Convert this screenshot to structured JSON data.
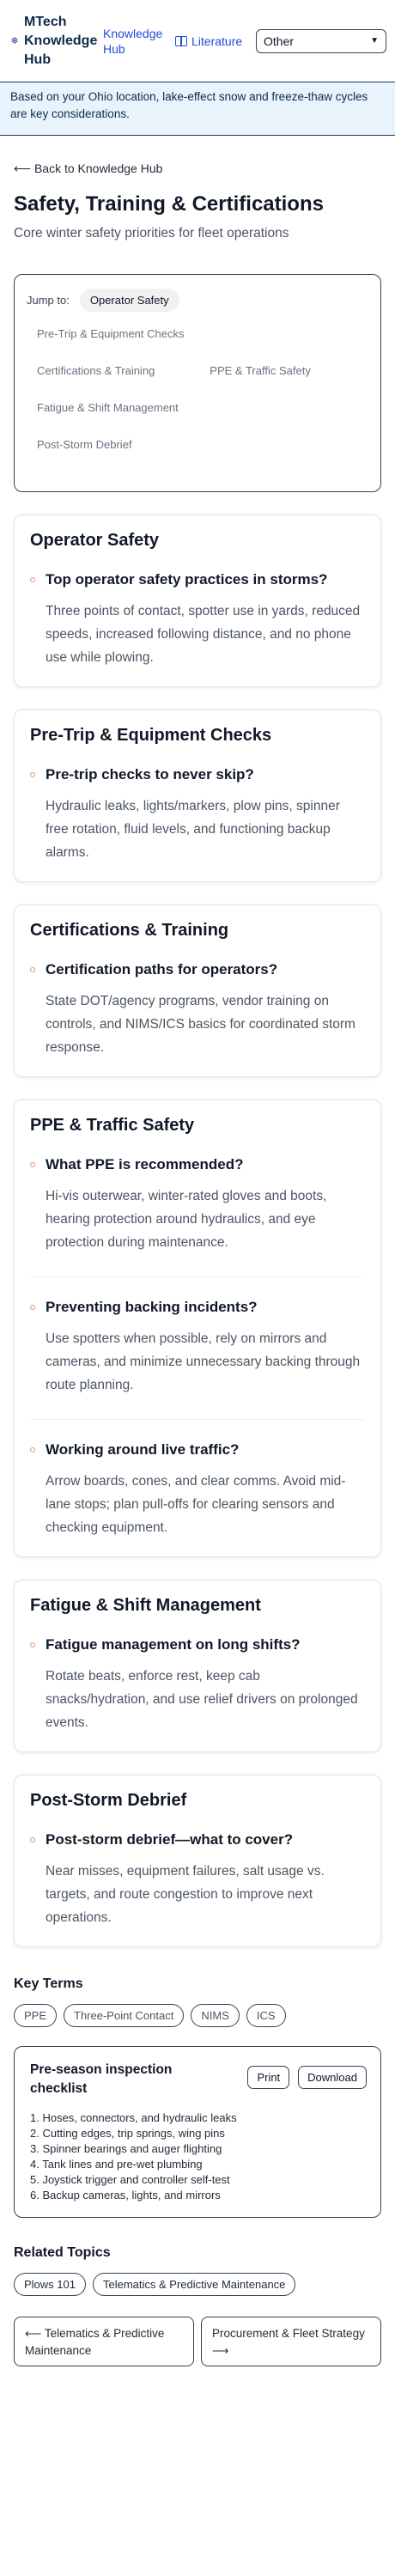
{
  "header": {
    "brand": "MTech Knowledge Hub",
    "brand_icon": "snowflake-icon",
    "nav_knowledge": "Knowledge Hub",
    "nav_literature": "Literature",
    "nav_literature_icon": "book-icon",
    "select_value": "Other"
  },
  "banner": "Based on your Ohio location, lake-effect snow and freeze-thaw cycles are key considerations.",
  "back_link": "⟵ Back to Knowledge Hub",
  "page": {
    "title": "Safety, Training & Certifications",
    "subtitle": "Core winter safety priorities for fleet operations"
  },
  "jump": {
    "label": "Jump to:",
    "active": "Operator Safety",
    "links": [
      "Pre-Trip & Equipment Checks",
      "Certifications & Training",
      "PPE & Traffic Safety",
      "Fatigue & Shift Management",
      "Post-Storm Debrief"
    ]
  },
  "sections": [
    {
      "title": "Operator Safety",
      "items": [
        {
          "q": "Top operator safety practices in storms?",
          "a": "Three points of contact, spotter use in yards, reduced speeds, increased following distance, and no phone use while plowing."
        }
      ]
    },
    {
      "title": "Pre-Trip & Equipment Checks",
      "items": [
        {
          "q": "Pre-trip checks to never skip?",
          "a": "Hydraulic leaks, lights/markers, plow pins, spinner free rotation, fluid levels, and functioning backup alarms."
        }
      ]
    },
    {
      "title": "Certifications & Training",
      "items": [
        {
          "q": "Certification paths for operators?",
          "a": "State DOT/agency programs, vendor training on controls, and NIMS/ICS basics for coordinated storm response."
        }
      ]
    },
    {
      "title": "PPE & Traffic Safety",
      "items": [
        {
          "q": "What PPE is recommended?",
          "a": "Hi-vis outerwear, winter-rated gloves and boots, hearing protection around hydraulics, and eye protection during maintenance."
        },
        {
          "q": "Preventing backing incidents?",
          "a": "Use spotters when possible, rely on mirrors and cameras, and minimize unnecessary backing through route planning."
        },
        {
          "q": "Working around live traffic?",
          "a": "Arrow boards, cones, and clear comms. Avoid mid-lane stops; plan pull-offs for clearing sensors and checking equipment."
        }
      ]
    },
    {
      "title": "Fatigue & Shift Management",
      "items": [
        {
          "q": "Fatigue management on long shifts?",
          "a": "Rotate beats, enforce rest, keep cab snacks/hydration, and use relief drivers on prolonged events."
        }
      ]
    },
    {
      "title": "Post-Storm Debrief",
      "items": [
        {
          "q": "Post-storm debrief—what to cover?",
          "a": "Near misses, equipment failures, salt usage vs. targets, and route congestion to improve next operations."
        }
      ]
    }
  ],
  "key_terms": {
    "title": "Key Terms",
    "terms": [
      "PPE",
      "Three-Point Contact",
      "NIMS",
      "ICS"
    ]
  },
  "checklist": {
    "title": "Pre-season inspection checklist",
    "print_label": "Print",
    "download_label": "Download",
    "items": [
      "1. Hoses, connectors, and hydraulic leaks",
      "2. Cutting edges, trip springs, wing pins",
      "3. Spinner bearings and auger flighting",
      "4. Tank lines and pre-wet plumbing",
      "5. Joystick trigger and controller self-test",
      "6. Backup cameras, lights, and mirrors"
    ]
  },
  "related": {
    "title": "Related Topics",
    "topics": [
      "Plows 101",
      "Telematics & Predictive Maintenance"
    ]
  },
  "pager": {
    "prev": "⟵ Telematics & Predictive Maintenance",
    "next": "Procurement & Fleet Strategy ⟶"
  },
  "colors": {
    "accent": "#1d4ed8",
    "brand": "#0f2a4a",
    "banner_bg": "#e8f3fb",
    "bullet": "#f08a7a"
  }
}
